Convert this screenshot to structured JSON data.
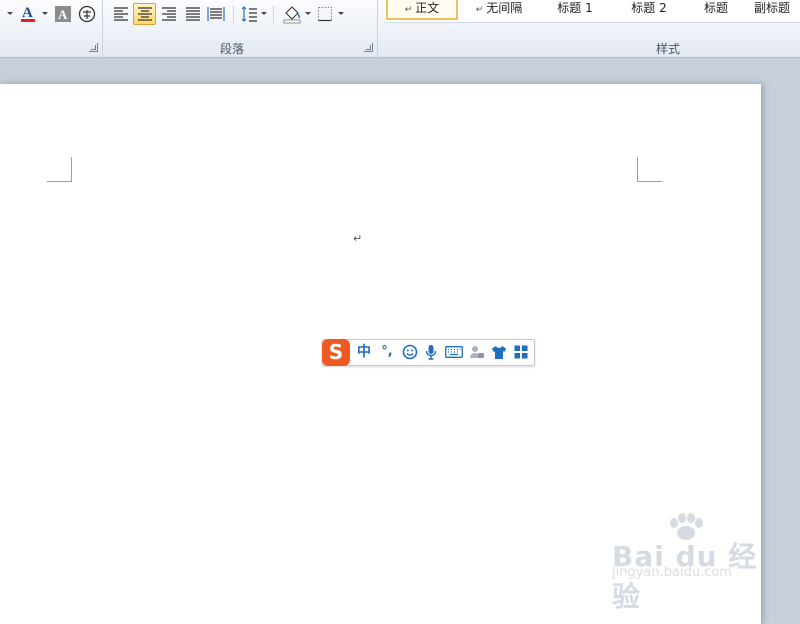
{
  "ribbon": {
    "font_group": {
      "text_color_accent": "#e32222"
    },
    "paragraph_group": {
      "label": "段落"
    },
    "styles_group": {
      "label": "样式",
      "items": [
        {
          "label": "正文",
          "marker": "↵",
          "selected": true
        },
        {
          "label": "无间隔",
          "marker": "↵",
          "selected": false
        },
        {
          "label": "标题 1",
          "marker": "",
          "selected": false
        },
        {
          "label": "标题 2",
          "marker": "",
          "selected": false
        },
        {
          "label": "标题",
          "marker": "",
          "selected": false
        },
        {
          "label": "副标题",
          "marker": "",
          "selected": false
        }
      ]
    }
  },
  "document": {
    "paragraph_mark": "↵"
  },
  "ime_toolbar": {
    "logo": "S",
    "mode": "中",
    "punctuation": "°,",
    "accent": "#1d6fc2",
    "logo_color": "#f05a22"
  },
  "watermark": {
    "brand": "Bai du 经验",
    "url": "jingyan.baidu.com"
  }
}
